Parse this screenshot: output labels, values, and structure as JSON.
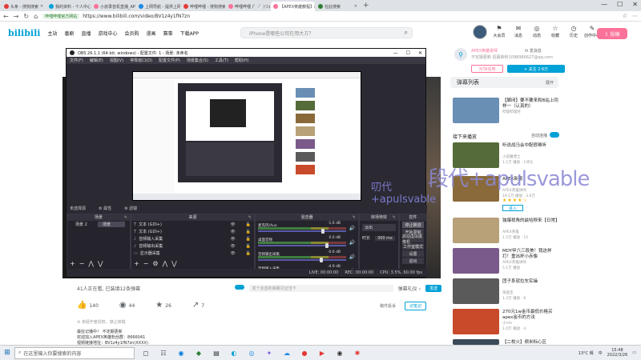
{
  "browser": {
    "tabs": [
      {
        "label": "头条 - 搜狗搜索",
        "color": "#e53935"
      },
      {
        "label": "我的资料 - 个人中心 - 头条",
        "color": "#00a1d6"
      },
      {
        "label": "小叔录音机直播_APEX英雄直播",
        "color": "#fb7299"
      },
      {
        "label": "上网导航 - 提供上网 从这里开始",
        "color": "#1e88e5"
      },
      {
        "label": "哔哩哔哩 - 搜狗搜索",
        "color": "#e53935"
      },
      {
        "label": "哔哩哔哩 (゜-゜)つロ 干杯~-bilibili",
        "color": "#fb7299"
      },
      {
        "label": "【APEX英雄教程】最适合大部分...",
        "color": "#fb7299"
      },
      {
        "label": "在此搜索",
        "color": "#2e7d32"
      }
    ],
    "new_tab": "+",
    "window_controls": [
      "—",
      "☐",
      "✕"
    ],
    "nav_icons": [
      "←",
      "→",
      "↻",
      "⌂"
    ],
    "safe_badge": "哔哩哔哩官方网站",
    "url": "https://www.bilibili.com/video/BV1z4y1fN7zn",
    "right_icons": [
      "☆",
      "⋯"
    ]
  },
  "bili": {
    "logo": "bilibili",
    "nav": [
      "主站",
      "番剧",
      "直播",
      "游戏中心",
      "会员购",
      "漫画",
      "赛事",
      "下载APP"
    ],
    "search_placeholder": "iPhone是哪些公司在用大方？",
    "search_icon": "⌕",
    "icons": [
      {
        "glyph": "⚑",
        "label": "大会员"
      },
      {
        "glyph": "✉",
        "label": "消息"
      },
      {
        "glyph": "◎",
        "label": "动态"
      },
      {
        "glyph": "☆",
        "label": "收藏"
      },
      {
        "glyph": "◷",
        "label": "历史"
      },
      {
        "glyph": "✎",
        "label": "创作中心"
      }
    ],
    "upload": "⇪ 投稿"
  },
  "page": {
    "danmu_info": "41人正在看, 已装填12条弹幕",
    "danmu_placeholder": "发个友善的弹幕见证当下",
    "danmu_etiquette": "弹幕礼仪 ›",
    "send": "发送",
    "likes": "140",
    "coins": "44",
    "favs": "26",
    "shares": "7",
    "report": "稿件投诉",
    "note": "记笔记",
    "authorized": "⊘ 未经作者授权，禁止转载",
    "desc_lines": [
      "最狂记播中！ 不定期更新",
      "欢迎加入APEX英雄粉丝群：8666041",
      "视频链接地址：BV1z4y1fN7zn(XXXX)"
    ]
  },
  "sidebar": {
    "up_name": "APEX英雄讲师",
    "send_msg": "✉ 发消息",
    "up_line": "不定期更新 招募新粉1098966627@qq.com",
    "up_line2": "",
    "charge": "为TA充电",
    "follow": "+ 关注 2.6万",
    "dmlist": "弹幕列表",
    "dmlist_r": "展开",
    "next_play": "接下来播放",
    "autoplay": "自动连播",
    "recs": [
      {
        "title": "【脚闭】要不要来和B站上同样一（认真的）",
        "meta": "哔哩哔哩吧",
        "meta2": "",
        "color": "#6a8fb5"
      },
      {
        "title": "听说战马会中配很难听",
        "meta": "小恶魔博士",
        "meta2": "1.1万 播放 · 1评论",
        "color": "#556b3a"
      },
      {
        "title": "APEX新版",
        "meta": "APEX英雄讲师",
        "meta2": "19.1万 播放 · 3.6万",
        "color": "#8a6a3a"
      },
      {
        "title": "独爆视角的兹哈穆来【日常】",
        "meta": "APEX英雄",
        "meta2": "1.5万 播放 · 15",
        "color": "#b8a078"
      },
      {
        "title": "MDY甲六三段美！我这样打！重出杯小赤像",
        "meta": "APEX英雄讲师",
        "meta2": "5.1万 播放",
        "color": "#7a5a8a"
      },
      {
        "title": "团子系就拉车实操",
        "meta": "海盗宝",
        "meta2": "1.3万 播放 · 6",
        "color": "#5a5a5a"
      },
      {
        "title": "270元1w金币最低价格买apex金币的方法",
        "meta": "小rim",
        "meta2": "1.0万 播放 · 4",
        "color": "#c84a2a"
      },
      {
        "title": "【二枚火】频米标心区",
        "meta": "",
        "meta2": "",
        "color": "#3a4a5a"
      }
    ],
    "stars": "★★★★☆",
    "enter": "进入"
  },
  "obs": {
    "title": "OBS 26.1.1 (64-bit, windows) - 配置文件: 1 - 场景: 未命名",
    "menu": [
      "文件(F)",
      "编辑(E)",
      "视图(V)",
      "停靠窗口(D)",
      "配置文件(P)",
      "场景集合(S)",
      "工具(T)",
      "帮助(H)"
    ],
    "watermark": "叨代+apulsvable",
    "watermark_big": "段代+apulsvable",
    "source_bar": [
      "未选择源",
      "⚙ 属性",
      "⚙ 滤镜"
    ],
    "panels": {
      "scenes": "场景",
      "sources": "来源",
      "mixer": "混音器",
      "transitions": "转场特效",
      "controls": "控件"
    },
    "scenes": [
      "场景 2",
      "场景"
    ],
    "sources": [
      {
        "icon": "T",
        "label": "文本 (GDI+)"
      },
      {
        "icon": "T",
        "label": "文本 (GDI+)"
      },
      {
        "icon": "♪",
        "label": "音频输入采集"
      },
      {
        "icon": "♪",
        "label": "音频输出采集"
      },
      {
        "icon": "▭",
        "label": "显示器采集"
      }
    ],
    "mixer": [
      {
        "label": "麦克风/Aux",
        "db": "-1.6 dB"
      },
      {
        "label": "桌面音频",
        "db": "0.0 dB"
      },
      {
        "label": "音频输出采集",
        "db": "-0.6 dB"
      },
      {
        "label": "音频输入采集",
        "db": "-4.9 dB"
      }
    ],
    "transition": "淡出",
    "duration_label": "时长",
    "duration": "300 ms",
    "controls": [
      "停止推流",
      "开始录制",
      "启动虚拟摄像机",
      "工作室模式",
      "设置",
      "退出"
    ],
    "status": [
      "LIVE: 00:00:00",
      "REC: 00:00:00",
      "CPU: 3.5%, 60.00 fps"
    ]
  },
  "taskbar": {
    "start": "⊞",
    "search": "在这里输入你要搜索的内容",
    "apps": [
      "◻",
      "☷",
      "◉",
      "◆",
      "▤",
      "◐",
      "◎",
      "✦",
      "☁",
      "●",
      "▶",
      "◉",
      "✱"
    ],
    "weather": "13°C 晴",
    "lang": "中",
    "time": "15:48",
    "date": "2022/3/26"
  }
}
